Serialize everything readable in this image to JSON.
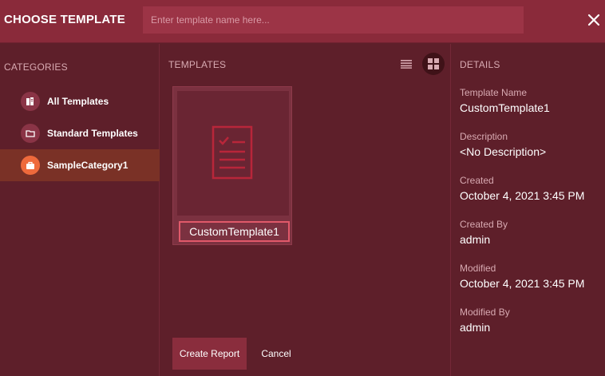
{
  "header": {
    "title": "CHOOSE TEMPLATE",
    "search_placeholder": "Enter template name here...",
    "close_icon": "close-icon"
  },
  "categories": {
    "heading": "CATEGORIES",
    "items": [
      {
        "label": "All Templates",
        "icon": "all-templates-icon",
        "active": false
      },
      {
        "label": "Standard Templates",
        "icon": "folder-icon",
        "active": false
      },
      {
        "label": "SampleCategory1",
        "icon": "briefcase-icon",
        "active": true
      }
    ]
  },
  "templates": {
    "heading": "TEMPLATES",
    "view_modes": [
      "list",
      "grid"
    ],
    "active_view": "grid",
    "items": [
      {
        "name": "CustomTemplate1",
        "icon": "document-checklist-icon"
      }
    ],
    "create_label": "Create Report",
    "cancel_label": "Cancel"
  },
  "details": {
    "heading": "DETAILS",
    "fields": [
      {
        "label": "Template Name",
        "value": "CustomTemplate1"
      },
      {
        "label": "Description",
        "value": "<No Description>"
      },
      {
        "label": "Created",
        "value": "October 4, 2021 3:45 PM"
      },
      {
        "label": "Created By",
        "value": "admin"
      },
      {
        "label": "Modified",
        "value": "October 4, 2021 3:45 PM"
      },
      {
        "label": "Modified By",
        "value": "admin"
      }
    ]
  },
  "colors": {
    "header_bg": "#8a2a3a",
    "panel_bg": "#5e1f2a",
    "active_category_bg": "#7a3126",
    "active_icon_bg": "#ef6a3c",
    "accent_border": "#e0596a"
  }
}
